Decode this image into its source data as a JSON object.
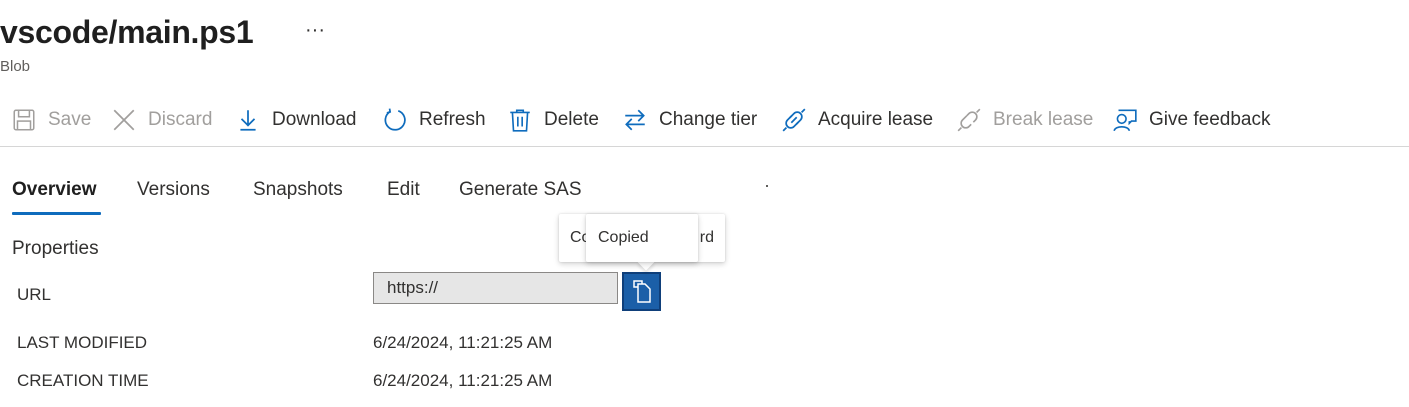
{
  "header": {
    "title": "vscode/main.ps1",
    "more_label": "···",
    "subtitle": "Blob"
  },
  "toolbar": {
    "items": [
      {
        "label": "Save",
        "icon": "save-icon",
        "enabled": false
      },
      {
        "label": "Discard",
        "icon": "close-icon",
        "enabled": false
      },
      {
        "label": "Download",
        "icon": "download-icon",
        "enabled": true
      },
      {
        "label": "Refresh",
        "icon": "refresh-icon",
        "enabled": true
      },
      {
        "label": "Delete",
        "icon": "trash-icon",
        "enabled": true
      },
      {
        "label": "Change tier",
        "icon": "swap-arrows-icon",
        "enabled": true
      },
      {
        "label": "Acquire lease",
        "icon": "link-icon",
        "enabled": true
      },
      {
        "label": "Break lease",
        "icon": "broken-link-icon",
        "enabled": false
      },
      {
        "label": "Give feedback",
        "icon": "feedback-icon",
        "enabled": true
      }
    ]
  },
  "tabs": {
    "items": [
      "Overview",
      "Versions",
      "Snapshots",
      "Edit",
      "Generate SAS"
    ],
    "active": "Overview"
  },
  "properties": {
    "heading": "Properties",
    "url_label": "URL",
    "url_value": "https://",
    "last_modified_label": "LAST MODIFIED",
    "last_modified_value": "6/24/2024, 11:21:25 AM",
    "creation_time_label": "CREATION TIME",
    "creation_time_value": "6/24/2024, 11:21:25 AM"
  },
  "tooltips": {
    "back_left": "Co",
    "back_right": "rd",
    "front": "Copied"
  },
  "colors": {
    "accent": "#0f6cbd",
    "copy_button": "#1b5fa8",
    "disabled_text": "#a19f9d"
  }
}
